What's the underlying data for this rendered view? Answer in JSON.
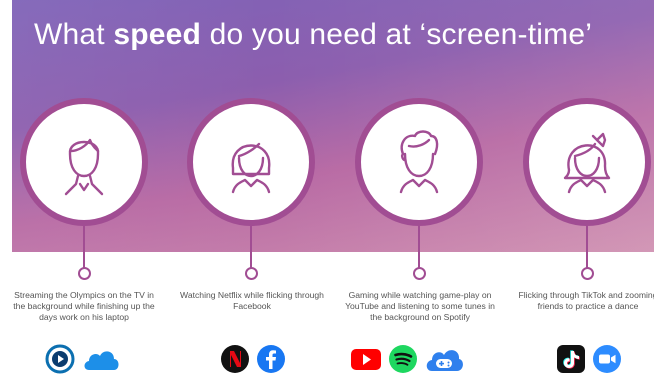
{
  "title": {
    "before": "What ",
    "bold": "speed",
    "after": " do you need at ‘screen-time’"
  },
  "personas": [
    {
      "caption": "Streaming the Olympics on the TV in the background while finishing up the days work on his laptop",
      "apps": [
        "play-circle-icon",
        "cloud-icon"
      ]
    },
    {
      "caption": "Watching Netflix while flicking through Facebook",
      "apps": [
        "netflix-icon",
        "facebook-icon"
      ]
    },
    {
      "caption": "Gaming while watching game-play on YouTube and listening to some tunes in the background on Spotify",
      "apps": [
        "youtube-icon",
        "spotify-icon",
        "cloud-gaming-icon"
      ]
    },
    {
      "caption": "Flicking through TikTok and zooming friends to practice a dance",
      "apps": [
        "tiktok-icon",
        "zoom-icon"
      ]
    }
  ],
  "colors": {
    "accent": "#a14d93",
    "banner_start": "#7f63b8",
    "banner_end": "#cf8fb0"
  }
}
